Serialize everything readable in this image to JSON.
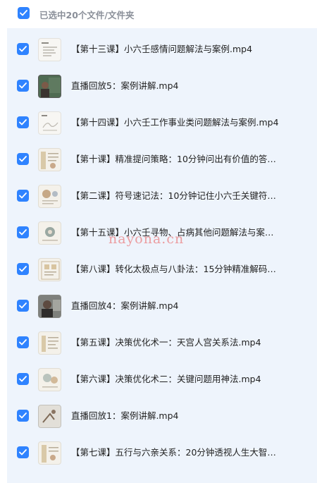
{
  "selection": {
    "summary": "已选中20个文件/文件夹"
  },
  "files": [
    {
      "name": "【第十三课】小六壬感情问题解法与案例.mp4",
      "thumb": "document-thumbnail"
    },
    {
      "name": "直播回放5：案例讲解.mp4",
      "thumb": "video-thumbnail"
    },
    {
      "name": "【第十四课】小六壬工作事业类问题解法与案例.mp4",
      "thumb": "document-thumbnail"
    },
    {
      "name": "【第十课】精准提问策略：10分钟问出有价值的答案...",
      "thumb": "document-thumbnail"
    },
    {
      "name": "【第二课】符号速记法：10分钟记住小六壬关键符号...",
      "thumb": "document-thumbnail"
    },
    {
      "name": "【第十五课】小六壬寻物、占病其他问题解法与案例....",
      "thumb": "document-thumbnail"
    },
    {
      "name": "【第八课】转化太极点与八卦法：15分钟精准解码预...",
      "thumb": "document-thumbnail"
    },
    {
      "name": "直播回放4：案例讲解.mp4",
      "thumb": "video-thumbnail"
    },
    {
      "name": "【第五课】决策优化术一：天宫人宫关系法.mp4",
      "thumb": "document-thumbnail"
    },
    {
      "name": "【第六课】决策优化术二：关键问题用神法.mp4",
      "thumb": "document-thumbnail"
    },
    {
      "name": "直播回放1：案例讲解.mp4",
      "thumb": "video-thumbnail"
    },
    {
      "name": "【第七课】五行与六亲关系：20分钟透视人生大智慧...",
      "thumb": "document-thumbnail"
    }
  ],
  "watermark": "nayona.cn",
  "colors": {
    "accent": "#2f83ff",
    "panel": "#eef4fc",
    "watermark": "#eb6e6e"
  }
}
